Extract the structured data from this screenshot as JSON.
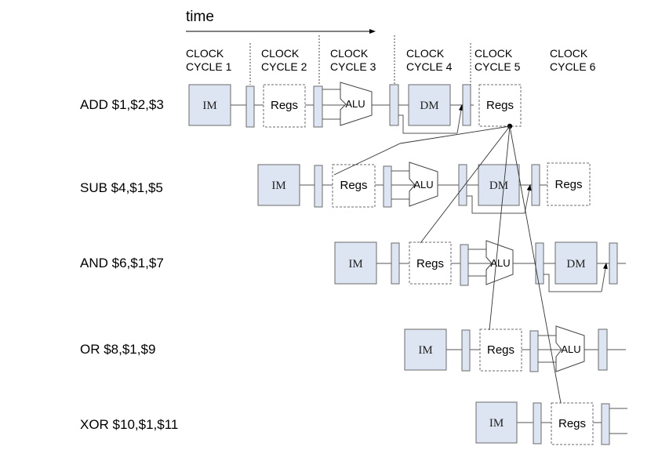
{
  "header": {
    "time_label": "time",
    "cycles": [
      {
        "line1": "CLOCK",
        "line2": "CYCLE 1"
      },
      {
        "line1": "CLOCK",
        "line2": "CYCLE 2"
      },
      {
        "line1": "CLOCK",
        "line2": "CYCLE 3"
      },
      {
        "line1": "CLOCK",
        "line2": "CYCLE 4"
      },
      {
        "line1": "CLOCK",
        "line2": "CYCLE 5"
      },
      {
        "line1": "CLOCK",
        "line2": "CYCLE 6"
      }
    ]
  },
  "instructions": [
    {
      "text": "ADD $1,$2,$3"
    },
    {
      "text": "SUB $4,$1,$5"
    },
    {
      "text": "AND $6,$1,$7"
    },
    {
      "text": "OR $8,$1,$9"
    },
    {
      "text": "XOR $10,$1,$11"
    }
  ],
  "stage_labels": {
    "im": "IM",
    "regs": "Regs",
    "alu": "ALU",
    "dm": "DM"
  }
}
